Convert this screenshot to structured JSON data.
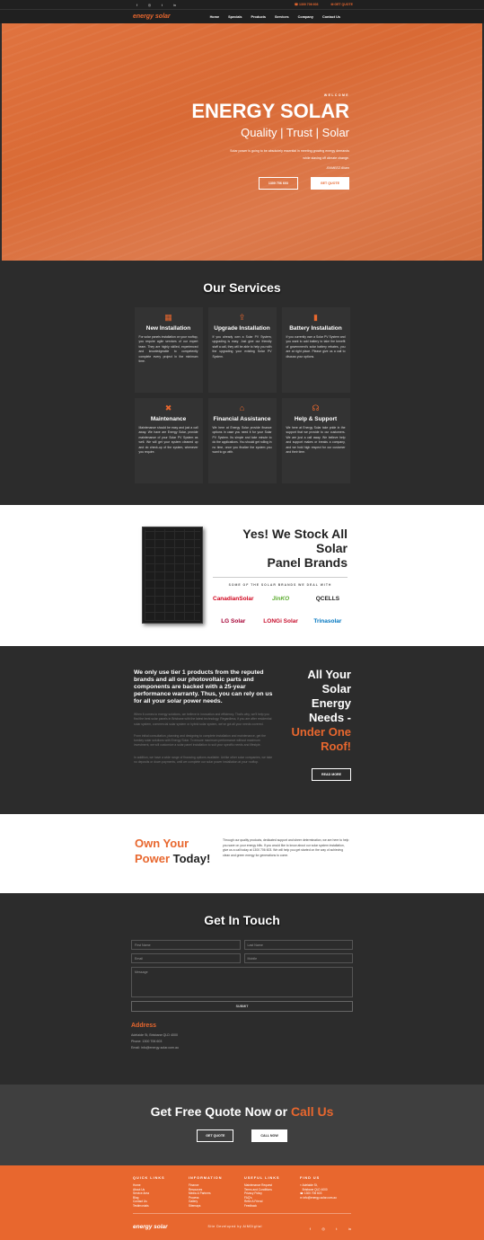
{
  "topbar": {
    "social_icons": [
      "facebook-icon",
      "instagram-icon",
      "twitter-icon",
      "linkedin-icon"
    ],
    "phone": "1300 706 603",
    "quote_label": "GET QUOTE"
  },
  "nav": {
    "logo": "energy solar",
    "links": [
      "Home",
      "Specials",
      "Products",
      "Services",
      "Company",
      "Contact Us"
    ]
  },
  "hero": {
    "welcome": "WELCOME",
    "title": "ENERGY SOLAR",
    "subtitle": "Quality | Trust | Solar",
    "quote": "Solar power is going to be absolutely essential in meeting growing energy demands while staving off climate change.",
    "author": "-RAMEEZ Akam",
    "btn_phone": "1300 706 603",
    "btn_quote": "GET QUOTE"
  },
  "services": {
    "title": "Our Services",
    "items": [
      {
        "icon": "solar-panel-icon",
        "title": "New Installation",
        "text": "For solar panels installation on your rooftop, you require agile services of our expert team. They are highly skilled, experienced and knowledgeable to competently complete every project in the minimum time."
      },
      {
        "icon": "upgrade-icon",
        "title": "Upgrade Installation",
        "text": "If you already own a Solar PV System, upgrading is easy. Just give our friendly staff a call, they will be able to help you with the upgrading your existing Solar PV System."
      },
      {
        "icon": "battery-icon",
        "title": "Battery Installation",
        "text": "If you currently own a Solar PV System and you want to add battery to take the benefit of government's solar battery rebates, you are at right place. Please give us a call to discuss your options."
      },
      {
        "icon": "tools-icon",
        "title": "Maintenance",
        "text": "Maintenance should be easy and just a call away. We have are Energy Solar, provide maintenance of your Solar PV System as well. We will get your system cleaned up and do check-up of the system, whenever you require."
      },
      {
        "icon": "bank-icon",
        "title": "Financial Assistance",
        "text": "We here at Energy Solar provide finance options in case you need it for your Solar PV System. Its simple and take minute to do the applications. You should get rolling in no time, once you finalize the system you want to go with."
      },
      {
        "icon": "headset-icon",
        "title": "Help & Support",
        "text": "We here at Energy Solar take pride in the support that we provide to our customers. We are just a call away. We believe help and support makes or breaks a company, and we hold high respect for our customer and their time."
      }
    ]
  },
  "brands": {
    "title_line1": "Yes! We Stock All Solar",
    "title_line2": "Panel Brands",
    "subtitle": "SOME OF THE SOLAR BRANDS WE DEAL WITH",
    "logos": [
      {
        "name": "CanadianSolar",
        "color": "#d0021b"
      },
      {
        "name": "JinKO",
        "color": "#5aab2e"
      },
      {
        "name": "QCELLS",
        "color": "#222222"
      },
      {
        "name": "LG Solar",
        "color": "#a50034"
      },
      {
        "name": "LONGi Solar",
        "color": "#c8102e"
      },
      {
        "name": "Trinasolar",
        "color": "#0076c0"
      }
    ]
  },
  "energy": {
    "lead": "We only use tier 1 products from the reputed brands and all our photovoltaic parts and components are backed with a 25-year performance warranty. Thus, you can rely on us for all your solar power needs.",
    "p1": "When it comes to energy solutions, we believe in innovation and efficiency. That's why, we'll help you find the best solar panels in Brisbane with the latest technology. Regardless, if you are after residential solar system, commercial solar system or hybrid solar system, we've got all your needs covered.",
    "p2": "From initial consultation, planning and designing to complete installation and maintenance, get the turnkey solar solutions with Energy Solar. To ensure maximum performance without maximum investment, we will customize a solar panel installation to suit your specific needs and lifestyle.",
    "p3": "In addition, we have a wide range of financing options available. Unlike other solar companies, we take no deposits or down payments, until we complete our solar power installation at your rooftop.",
    "h_line1": "All Your",
    "h_line2": "Solar",
    "h_line3": "Energy",
    "h_line4": "Needs -",
    "h_line5": "Under One",
    "h_line6": "Roof!",
    "btn": "READ MORE"
  },
  "own": {
    "w1": "Own Your",
    "w2": "Power",
    "w3": "Today!",
    "text": "Through our quality products, dedicated support and sheer determination, we are here to help you save on your energy bills. If you would like to know about our solar system installation, give us a call today at 1300 706 603. We will help you get started on the way of achieving clean and green energy for generations to come."
  },
  "contact": {
    "title": "Get In Touch",
    "first_name": "First Name",
    "last_name": "Last Name",
    "email": "Email",
    "mobile": "Mobile",
    "message": "Message",
    "submit": "SUBMIT",
    "address_title": "Address",
    "address": "Adelaide St, Brisbane QLD 4000",
    "phone": "Phone: 1300 706 603",
    "email_line": "Email: info@energy-solar.com.au"
  },
  "freequote": {
    "part1": "Get Free Quote Now or",
    "part2": "Call Us",
    "btn_quote": "GET QUOTE",
    "btn_call": "CALL NOW"
  },
  "footer": {
    "col1_title": "QUICK LINKS",
    "col1": [
      "Home",
      "About Us",
      "Service Area",
      "Blog",
      "Contact Us",
      "Testimonials"
    ],
    "col2_title": "INFORMATION",
    "col2": [
      "Finance",
      "Resources",
      "Media & Partners",
      "Process",
      "Gallery",
      "Sitemaps"
    ],
    "col3_title": "USEFUL LINKS",
    "col3": [
      "Maintenance Request",
      "Terms and Conditions",
      "Privacy Policy",
      "FAQ's",
      "Refer A Friend",
      "Feedback"
    ],
    "col4_title": "FIND US",
    "address_line1": "Adelaide St,",
    "address_line2": "Brisbane QLD 4000",
    "phone": "1300 706 603",
    "email": "info@energy-solar.com.au",
    "logo": "energy solar",
    "credit": "Site Developed by AIMDigital",
    "social_icons": [
      "facebook-icon",
      "instagram-icon",
      "twitter-icon",
      "linkedin-icon"
    ]
  }
}
